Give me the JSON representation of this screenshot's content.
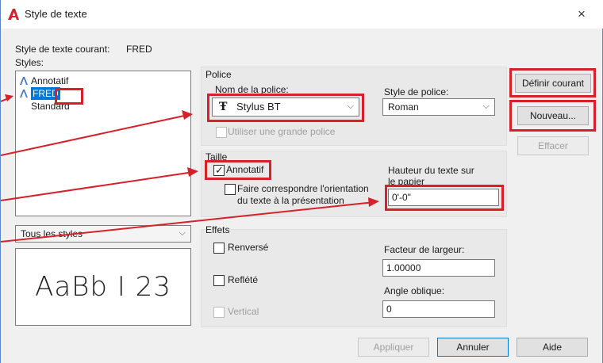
{
  "window": {
    "title": "Style de texte",
    "close_glyph": "×",
    "app_icon": "autocad-a-icon"
  },
  "current_style": {
    "label": "Style de texte courant:",
    "value": "FRED"
  },
  "styles": {
    "label": "Styles:",
    "items": [
      {
        "label": "Annotatif",
        "icon": "annotative-icon",
        "selected": false
      },
      {
        "label": "FRED",
        "icon": "annotative-icon",
        "selected": true
      },
      {
        "label": "Standard",
        "icon": "",
        "selected": false
      }
    ],
    "filter_value": "Tous les styles"
  },
  "preview": {
    "sample": "AaBb I 23"
  },
  "police": {
    "group_label": "Police",
    "font_name_label": "Nom de la police:",
    "font_name_value": "Stylus BT",
    "font_style_label": "Style de police:",
    "font_style_value": "Roman",
    "big_font_label": "Utiliser une grande police"
  },
  "taille": {
    "group_label": "Taille",
    "annotative_label": "Annotatif",
    "annotative_checked": true,
    "match_orientation_label_1": "Faire correspondre l'orientation",
    "match_orientation_label_2": "du texte à la présentation",
    "paper_height_label_1": "Hauteur du texte sur",
    "paper_height_label_2": "le papier",
    "paper_height_value": "0'-0\""
  },
  "effets": {
    "group_label": "Effets",
    "upside_down_label": "Renversé",
    "backwards_label": "Reflété",
    "vertical_label": "Vertical",
    "width_factor_label": "Facteur de largeur:",
    "width_factor_value": "1.00000",
    "oblique_angle_label": "Angle oblique:",
    "oblique_angle_value": "0"
  },
  "buttons": {
    "set_current": "Définir courant",
    "new": "Nouveau...",
    "delete": "Effacer",
    "apply": "Appliquer",
    "cancel": "Annuler",
    "help": "Aide"
  },
  "colors": {
    "annotation_red": "#d6202a",
    "selection_blue": "#0078d7",
    "autocad_red": "#d6202a"
  }
}
